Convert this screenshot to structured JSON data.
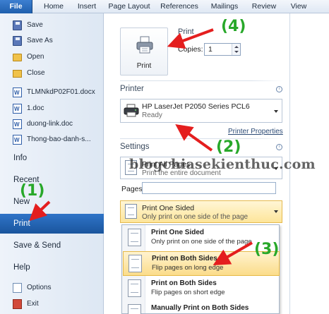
{
  "ribbon": {
    "tabs": [
      "File",
      "Home",
      "Insert",
      "Page Layout",
      "References",
      "Mailings",
      "Review",
      "View"
    ]
  },
  "nav": {
    "top": [
      {
        "label": "Save",
        "icon": "save-icon"
      },
      {
        "label": "Save As",
        "icon": "save-as-icon"
      },
      {
        "label": "Open",
        "icon": "folder-icon"
      },
      {
        "label": "Close",
        "icon": "close-document-icon"
      }
    ],
    "recent_docs": [
      "TLMNkdP02F01.docx",
      "1.doc",
      "duong-link.doc",
      "Thong-bao-danh-s..."
    ],
    "info": "Info",
    "recent": "Recent",
    "new": "New",
    "print": "Print",
    "save_send": "Save & Send",
    "help": "Help",
    "options": "Options",
    "exit": "Exit"
  },
  "print": {
    "section_title": "Print",
    "button_label": "Print",
    "copies_label": "Copies:",
    "copies_value": "1"
  },
  "printer": {
    "section_title": "Printer",
    "name": "HP LaserJet P2050 Series PCL6",
    "status": "Ready",
    "properties_link": "Printer Properties"
  },
  "settings": {
    "section_title": "Settings",
    "range": {
      "title": "Print All Pages",
      "desc": "Print the entire document"
    },
    "pages_label": "Pages:",
    "pages_value": "",
    "sided": {
      "title": "Print One Sided",
      "desc": "Only print on one side of the page"
    },
    "menu": [
      {
        "title": "Print One Sided",
        "desc": "Only print on one side of the page"
      },
      {
        "title": "Print on Both Sides",
        "desc": "Flip pages on long edge"
      },
      {
        "title": "Print on Both Sides",
        "desc": "Flip pages on short edge"
      },
      {
        "title": "Manually Print on Both Sides",
        "desc": ""
      }
    ]
  },
  "annotations": {
    "step1": "(1)",
    "step2": "(2)",
    "step3": "(3)",
    "step4": "(4)",
    "watermark": "blogchiasekienthuc.com",
    "colors": {
      "step_label": "#28a82a",
      "arrow": "#e41e1e",
      "accent": "#1a559d",
      "hover": "#fbdc8a"
    }
  }
}
